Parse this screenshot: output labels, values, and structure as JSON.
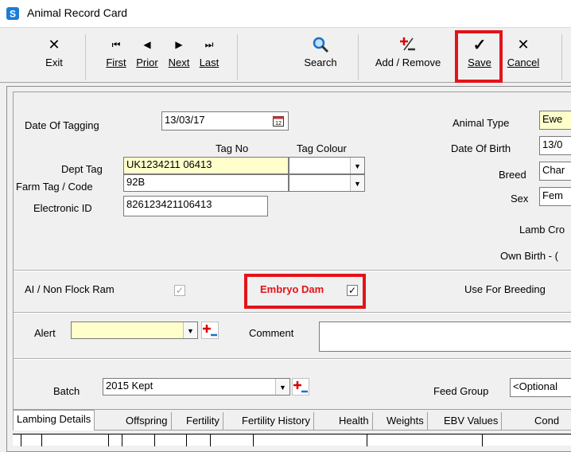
{
  "window": {
    "title": "Animal Record Card"
  },
  "toolbar": {
    "exit": "Exit",
    "first": "First",
    "prior": "Prior",
    "next": "Next",
    "last": "Last",
    "search": "Search",
    "add_remove": "Add / Remove",
    "save": "Save",
    "cancel": "Cancel"
  },
  "form": {
    "date_of_tagging_label": "Date Of Tagging",
    "date_of_tagging_value": "13/03/17",
    "tag_no_header": "Tag No",
    "tag_colour_header": "Tag Colour",
    "dept_tag_label": "Dept Tag",
    "dept_tag_value": "UK1234211 06413",
    "farm_tag_label": "Farm Tag / Code",
    "farm_tag_value": "92B",
    "electronic_id_label": "Electronic ID",
    "electronic_id_value": "826123421106413",
    "animal_type_label": "Animal Type",
    "animal_type_value": "Ewe",
    "date_of_birth_label": "Date Of Birth",
    "date_of_birth_value": "13/0",
    "breed_label": "Breed",
    "breed_value": "Char",
    "sex_label": "Sex",
    "sex_value": "Fem",
    "lamb_cross_label": "Lamb Cro",
    "own_birth_label": "Own Birth - (",
    "ai_label": "AI / Non Flock Ram",
    "ai_checked": "✓",
    "embryo_label": "Embryo Dam",
    "embryo_checked": "✓",
    "use_for_breeding_label": "Use For Breeding",
    "alert_label": "Alert",
    "alert_value": "",
    "comment_label": "Comment",
    "comment_value": "",
    "batch_label": "Batch",
    "batch_value": "2015 Kept",
    "feed_group_label": "Feed Group",
    "feed_group_value": "<Optional"
  },
  "tabs": [
    "Lambing Details",
    "Offspring",
    "Fertility",
    "Fertility History",
    "Health",
    "Weights",
    "EBV Values",
    "Cond"
  ],
  "colors": {
    "highlight": "#e4131a",
    "embryo_text": "#e4131a",
    "field_yellow": "#ffffcc"
  }
}
